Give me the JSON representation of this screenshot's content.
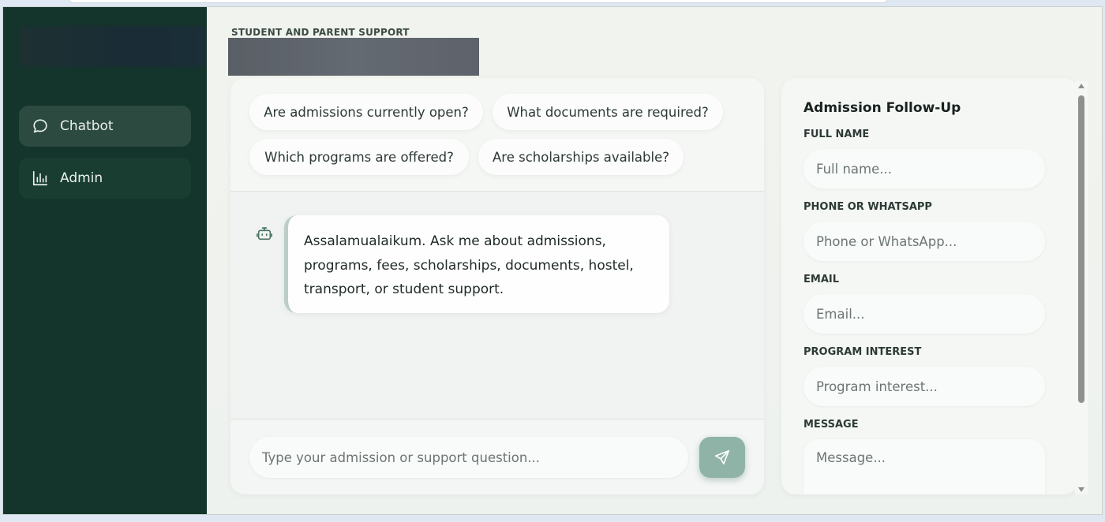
{
  "sidebar": {
    "items": [
      {
        "label": "Chatbot",
        "icon": "chat-bubble-icon",
        "active": true
      },
      {
        "label": "Admin",
        "icon": "bar-chart-icon",
        "active": false
      }
    ]
  },
  "header": {
    "eyebrow": "STUDENT AND PARENT SUPPORT"
  },
  "chat": {
    "suggestions": [
      "Are admissions currently open?",
      "What documents are required?",
      "Which programs are offered?",
      "Are scholarships available?"
    ],
    "messages": [
      {
        "from": "bot",
        "text": "Assalamualaikum. Ask me about admissions, programs, fees, scholarships, documents, hostel, transport, or student support."
      }
    ],
    "input_placeholder": "Type your admission or support question..."
  },
  "form": {
    "title": "Admission Follow-Up",
    "fields": [
      {
        "label": "FULL NAME",
        "placeholder": "Full name..."
      },
      {
        "label": "PHONE OR WHATSAPP",
        "placeholder": "Phone or WhatsApp..."
      },
      {
        "label": "EMAIL",
        "placeholder": "Email..."
      },
      {
        "label": "PROGRAM INTEREST",
        "placeholder": "Program interest..."
      },
      {
        "label": "MESSAGE",
        "placeholder": "Message..."
      }
    ]
  },
  "colors": {
    "sidebar_bg": "#14352b",
    "nav_active_bg": "#2c4a40",
    "accent": "#8fb3a6",
    "bubble_border": "#b9cfc5"
  }
}
